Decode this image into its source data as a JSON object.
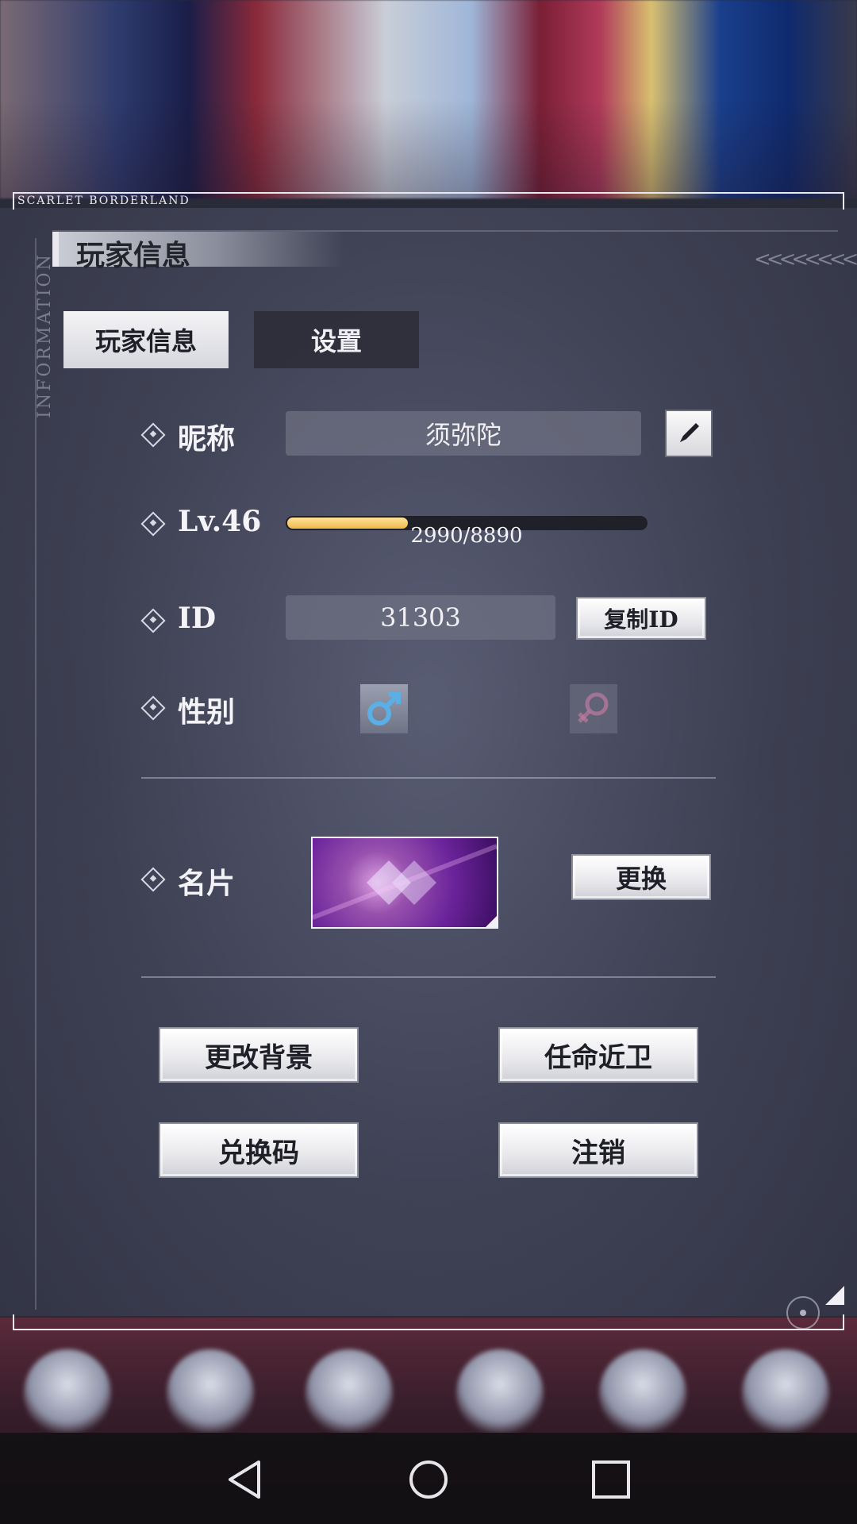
{
  "brand": "SCARLET BORDERLAND",
  "side_label": "INFORMATION",
  "title": "玩家信息",
  "tabs": [
    {
      "label": "玩家信息",
      "active": true
    },
    {
      "label": "设置",
      "active": false
    }
  ],
  "nickname": {
    "label": "昵称",
    "value": "须弥陀"
  },
  "level": {
    "label": "Lv.46",
    "xp_text": "2990/8890",
    "xp_fraction": 0.336
  },
  "id": {
    "label": "ID",
    "value": "31303",
    "copy_label": "复制ID"
  },
  "gender": {
    "label": "性别",
    "selected": "male"
  },
  "card": {
    "label": "名片",
    "change_label": "更换"
  },
  "actions": {
    "change_background": "更改背景",
    "appoint_guard": "任命近卫",
    "redeem_code": "兑换码",
    "logout": "注销"
  },
  "colors": {
    "accent_xp": "#f0b84a",
    "male_icon": "#5ab0e6",
    "female_icon": "#c07aa0"
  }
}
